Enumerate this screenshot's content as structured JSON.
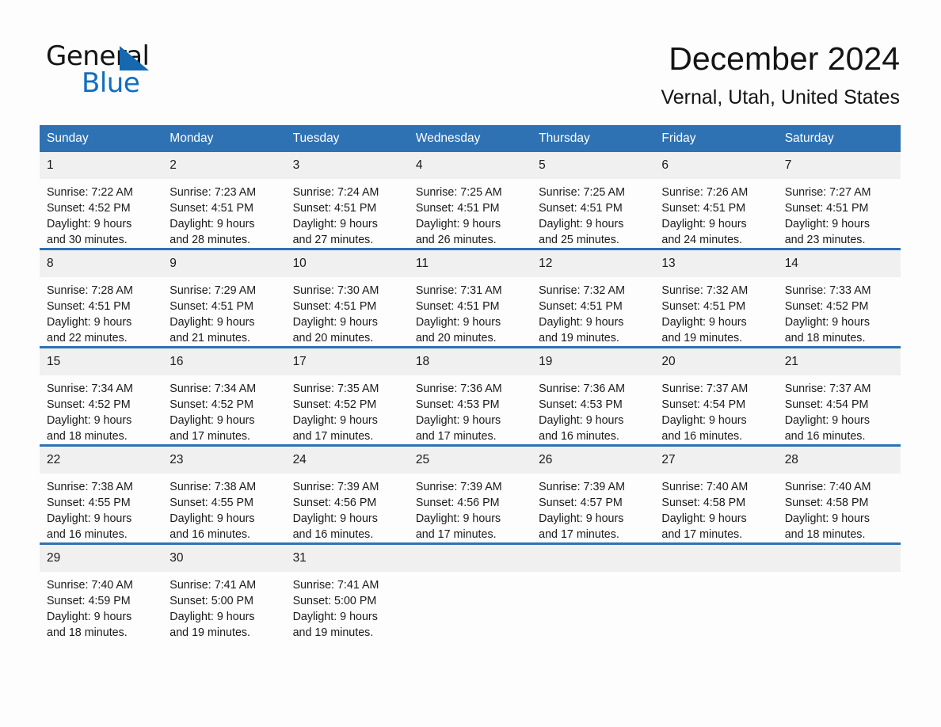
{
  "brand": {
    "name_part1": "General",
    "name_part2": "Blue",
    "accent_color": "#0f6fc0"
  },
  "header": {
    "title": "December 2024",
    "subtitle": "Vernal, Utah, United States"
  },
  "theme": {
    "header_bg": "#2e72b3",
    "daynum_bg": "#f0f0f0",
    "page_bg": "#fdfdfd"
  },
  "weekday_headers": [
    "Sunday",
    "Monday",
    "Tuesday",
    "Wednesday",
    "Thursday",
    "Friday",
    "Saturday"
  ],
  "weeks": [
    [
      {
        "day": "1",
        "sunrise": "Sunrise: 7:22 AM",
        "sunset": "Sunset: 4:52 PM",
        "daylight_line1": "Daylight: 9 hours",
        "daylight_line2": "and 30 minutes."
      },
      {
        "day": "2",
        "sunrise": "Sunrise: 7:23 AM",
        "sunset": "Sunset: 4:51 PM",
        "daylight_line1": "Daylight: 9 hours",
        "daylight_line2": "and 28 minutes."
      },
      {
        "day": "3",
        "sunrise": "Sunrise: 7:24 AM",
        "sunset": "Sunset: 4:51 PM",
        "daylight_line1": "Daylight: 9 hours",
        "daylight_line2": "and 27 minutes."
      },
      {
        "day": "4",
        "sunrise": "Sunrise: 7:25 AM",
        "sunset": "Sunset: 4:51 PM",
        "daylight_line1": "Daylight: 9 hours",
        "daylight_line2": "and 26 minutes."
      },
      {
        "day": "5",
        "sunrise": "Sunrise: 7:25 AM",
        "sunset": "Sunset: 4:51 PM",
        "daylight_line1": "Daylight: 9 hours",
        "daylight_line2": "and 25 minutes."
      },
      {
        "day": "6",
        "sunrise": "Sunrise: 7:26 AM",
        "sunset": "Sunset: 4:51 PM",
        "daylight_line1": "Daylight: 9 hours",
        "daylight_line2": "and 24 minutes."
      },
      {
        "day": "7",
        "sunrise": "Sunrise: 7:27 AM",
        "sunset": "Sunset: 4:51 PM",
        "daylight_line1": "Daylight: 9 hours",
        "daylight_line2": "and 23 minutes."
      }
    ],
    [
      {
        "day": "8",
        "sunrise": "Sunrise: 7:28 AM",
        "sunset": "Sunset: 4:51 PM",
        "daylight_line1": "Daylight: 9 hours",
        "daylight_line2": "and 22 minutes."
      },
      {
        "day": "9",
        "sunrise": "Sunrise: 7:29 AM",
        "sunset": "Sunset: 4:51 PM",
        "daylight_line1": "Daylight: 9 hours",
        "daylight_line2": "and 21 minutes."
      },
      {
        "day": "10",
        "sunrise": "Sunrise: 7:30 AM",
        "sunset": "Sunset: 4:51 PM",
        "daylight_line1": "Daylight: 9 hours",
        "daylight_line2": "and 20 minutes."
      },
      {
        "day": "11",
        "sunrise": "Sunrise: 7:31 AM",
        "sunset": "Sunset: 4:51 PM",
        "daylight_line1": "Daylight: 9 hours",
        "daylight_line2": "and 20 minutes."
      },
      {
        "day": "12",
        "sunrise": "Sunrise: 7:32 AM",
        "sunset": "Sunset: 4:51 PM",
        "daylight_line1": "Daylight: 9 hours",
        "daylight_line2": "and 19 minutes."
      },
      {
        "day": "13",
        "sunrise": "Sunrise: 7:32 AM",
        "sunset": "Sunset: 4:51 PM",
        "daylight_line1": "Daylight: 9 hours",
        "daylight_line2": "and 19 minutes."
      },
      {
        "day": "14",
        "sunrise": "Sunrise: 7:33 AM",
        "sunset": "Sunset: 4:52 PM",
        "daylight_line1": "Daylight: 9 hours",
        "daylight_line2": "and 18 minutes."
      }
    ],
    [
      {
        "day": "15",
        "sunrise": "Sunrise: 7:34 AM",
        "sunset": "Sunset: 4:52 PM",
        "daylight_line1": "Daylight: 9 hours",
        "daylight_line2": "and 18 minutes."
      },
      {
        "day": "16",
        "sunrise": "Sunrise: 7:34 AM",
        "sunset": "Sunset: 4:52 PM",
        "daylight_line1": "Daylight: 9 hours",
        "daylight_line2": "and 17 minutes."
      },
      {
        "day": "17",
        "sunrise": "Sunrise: 7:35 AM",
        "sunset": "Sunset: 4:52 PM",
        "daylight_line1": "Daylight: 9 hours",
        "daylight_line2": "and 17 minutes."
      },
      {
        "day": "18",
        "sunrise": "Sunrise: 7:36 AM",
        "sunset": "Sunset: 4:53 PM",
        "daylight_line1": "Daylight: 9 hours",
        "daylight_line2": "and 17 minutes."
      },
      {
        "day": "19",
        "sunrise": "Sunrise: 7:36 AM",
        "sunset": "Sunset: 4:53 PM",
        "daylight_line1": "Daylight: 9 hours",
        "daylight_line2": "and 16 minutes."
      },
      {
        "day": "20",
        "sunrise": "Sunrise: 7:37 AM",
        "sunset": "Sunset: 4:54 PM",
        "daylight_line1": "Daylight: 9 hours",
        "daylight_line2": "and 16 minutes."
      },
      {
        "day": "21",
        "sunrise": "Sunrise: 7:37 AM",
        "sunset": "Sunset: 4:54 PM",
        "daylight_line1": "Daylight: 9 hours",
        "daylight_line2": "and 16 minutes."
      }
    ],
    [
      {
        "day": "22",
        "sunrise": "Sunrise: 7:38 AM",
        "sunset": "Sunset: 4:55 PM",
        "daylight_line1": "Daylight: 9 hours",
        "daylight_line2": "and 16 minutes."
      },
      {
        "day": "23",
        "sunrise": "Sunrise: 7:38 AM",
        "sunset": "Sunset: 4:55 PM",
        "daylight_line1": "Daylight: 9 hours",
        "daylight_line2": "and 16 minutes."
      },
      {
        "day": "24",
        "sunrise": "Sunrise: 7:39 AM",
        "sunset": "Sunset: 4:56 PM",
        "daylight_line1": "Daylight: 9 hours",
        "daylight_line2": "and 16 minutes."
      },
      {
        "day": "25",
        "sunrise": "Sunrise: 7:39 AM",
        "sunset": "Sunset: 4:56 PM",
        "daylight_line1": "Daylight: 9 hours",
        "daylight_line2": "and 17 minutes."
      },
      {
        "day": "26",
        "sunrise": "Sunrise: 7:39 AM",
        "sunset": "Sunset: 4:57 PM",
        "daylight_line1": "Daylight: 9 hours",
        "daylight_line2": "and 17 minutes."
      },
      {
        "day": "27",
        "sunrise": "Sunrise: 7:40 AM",
        "sunset": "Sunset: 4:58 PM",
        "daylight_line1": "Daylight: 9 hours",
        "daylight_line2": "and 17 minutes."
      },
      {
        "day": "28",
        "sunrise": "Sunrise: 7:40 AM",
        "sunset": "Sunset: 4:58 PM",
        "daylight_line1": "Daylight: 9 hours",
        "daylight_line2": "and 18 minutes."
      }
    ],
    [
      {
        "day": "29",
        "sunrise": "Sunrise: 7:40 AM",
        "sunset": "Sunset: 4:59 PM",
        "daylight_line1": "Daylight: 9 hours",
        "daylight_line2": "and 18 minutes."
      },
      {
        "day": "30",
        "sunrise": "Sunrise: 7:41 AM",
        "sunset": "Sunset: 5:00 PM",
        "daylight_line1": "Daylight: 9 hours",
        "daylight_line2": "and 19 minutes."
      },
      {
        "day": "31",
        "sunrise": "Sunrise: 7:41 AM",
        "sunset": "Sunset: 5:00 PM",
        "daylight_line1": "Daylight: 9 hours",
        "daylight_line2": "and 19 minutes."
      },
      {
        "day": "",
        "sunrise": "",
        "sunset": "",
        "daylight_line1": "",
        "daylight_line2": ""
      },
      {
        "day": "",
        "sunrise": "",
        "sunset": "",
        "daylight_line1": "",
        "daylight_line2": ""
      },
      {
        "day": "",
        "sunrise": "",
        "sunset": "",
        "daylight_line1": "",
        "daylight_line2": ""
      },
      {
        "day": "",
        "sunrise": "",
        "sunset": "",
        "daylight_line1": "",
        "daylight_line2": ""
      }
    ]
  ]
}
